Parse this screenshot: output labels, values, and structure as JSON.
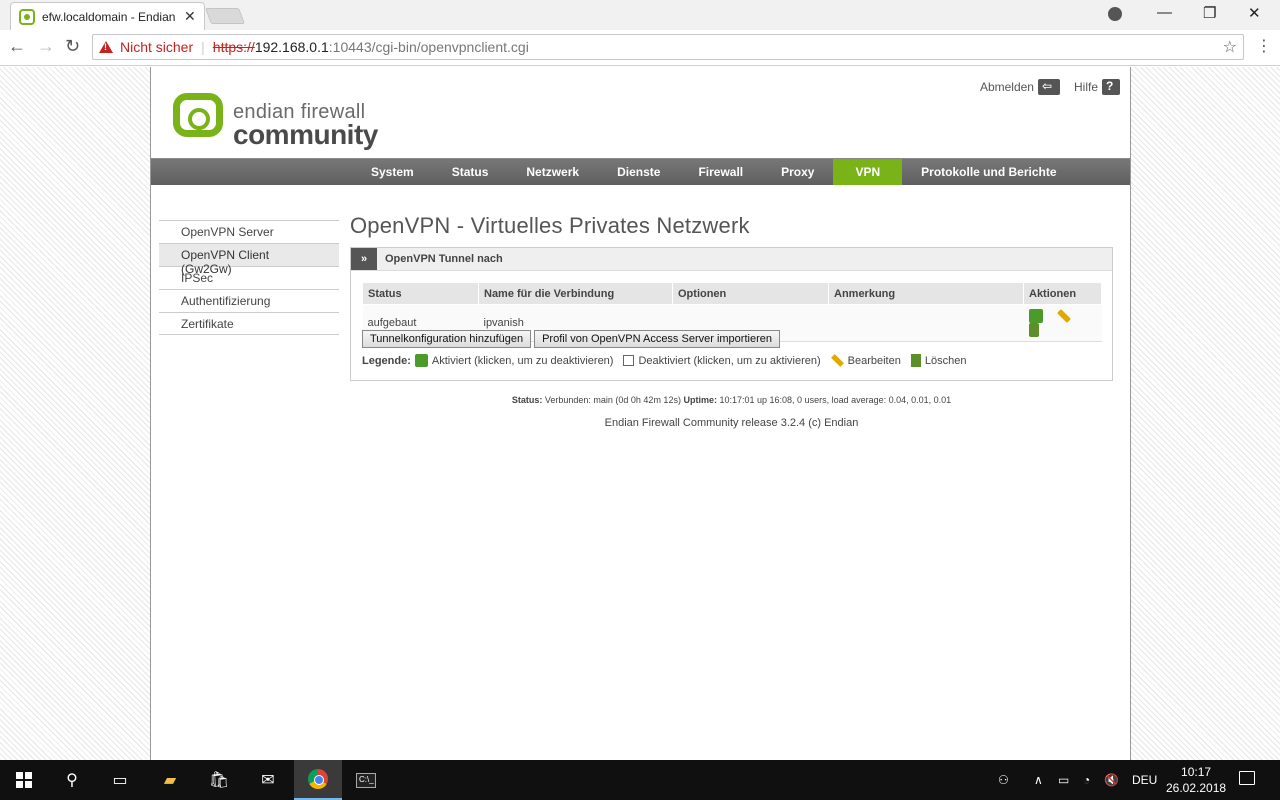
{
  "browser": {
    "tab_title": "efw.localdomain - Endian",
    "close_glyph": "✕",
    "security_label": "Nicht sicher",
    "url_scheme": "https://",
    "url_host": "192.168.0.1",
    "url_rest": ":10443/cgi-bin/openvpnclient.cgi"
  },
  "header": {
    "logo_line1": "endian firewall",
    "logo_line2": "community",
    "logout_label": "Abmelden",
    "help_label": "Hilfe"
  },
  "mainnav": {
    "items": [
      "System",
      "Status",
      "Netzwerk",
      "Dienste",
      "Firewall",
      "Proxy",
      "VPN",
      "Protokolle und Berichte"
    ],
    "active": "VPN"
  },
  "sidebar": {
    "items": [
      "OpenVPN Server",
      "OpenVPN Client (Gw2Gw)",
      "IPSec",
      "Authentifizierung",
      "Zertifikate"
    ],
    "active": "OpenVPN Client (Gw2Gw)"
  },
  "content": {
    "title": "OpenVPN - Virtuelles Privates Netzwerk",
    "box_toggle": "»",
    "box_title": "OpenVPN Tunnel nach",
    "table": {
      "headers": [
        "Status",
        "Name für die Verbindung",
        "Optionen",
        "Anmerkung",
        "Aktionen"
      ],
      "rows": [
        {
          "status": "aufgebaut",
          "name": "ipvanish",
          "options": "",
          "note": ""
        }
      ]
    },
    "buttons": {
      "add_tunnel": "Tunnelkonfiguration hinzufügen",
      "import_profile": "Profil von OpenVPN Access Server importieren"
    },
    "legend": {
      "label": "Legende:",
      "enabled": "Aktiviert (klicken, um zu deaktivieren)",
      "disabled": "Deaktiviert (klicken, um zu aktivieren)",
      "edit": "Bearbeiten",
      "delete": "Löschen"
    }
  },
  "status_line": {
    "status_label": "Status:",
    "status_value": "Verbunden: main (0d 0h 42m 12s)",
    "uptime_label": "Uptime:",
    "uptime_value": "10:17:01 up 16:08, 0 users, load average: 0.04, 0.01, 0.01"
  },
  "footer": "Endian Firewall Community release 3.2.4 (c) Endian",
  "taskbar": {
    "language": "DEU",
    "time": "10:17",
    "date": "26.02.2018",
    "terminal_glyph": "C:\\_"
  }
}
